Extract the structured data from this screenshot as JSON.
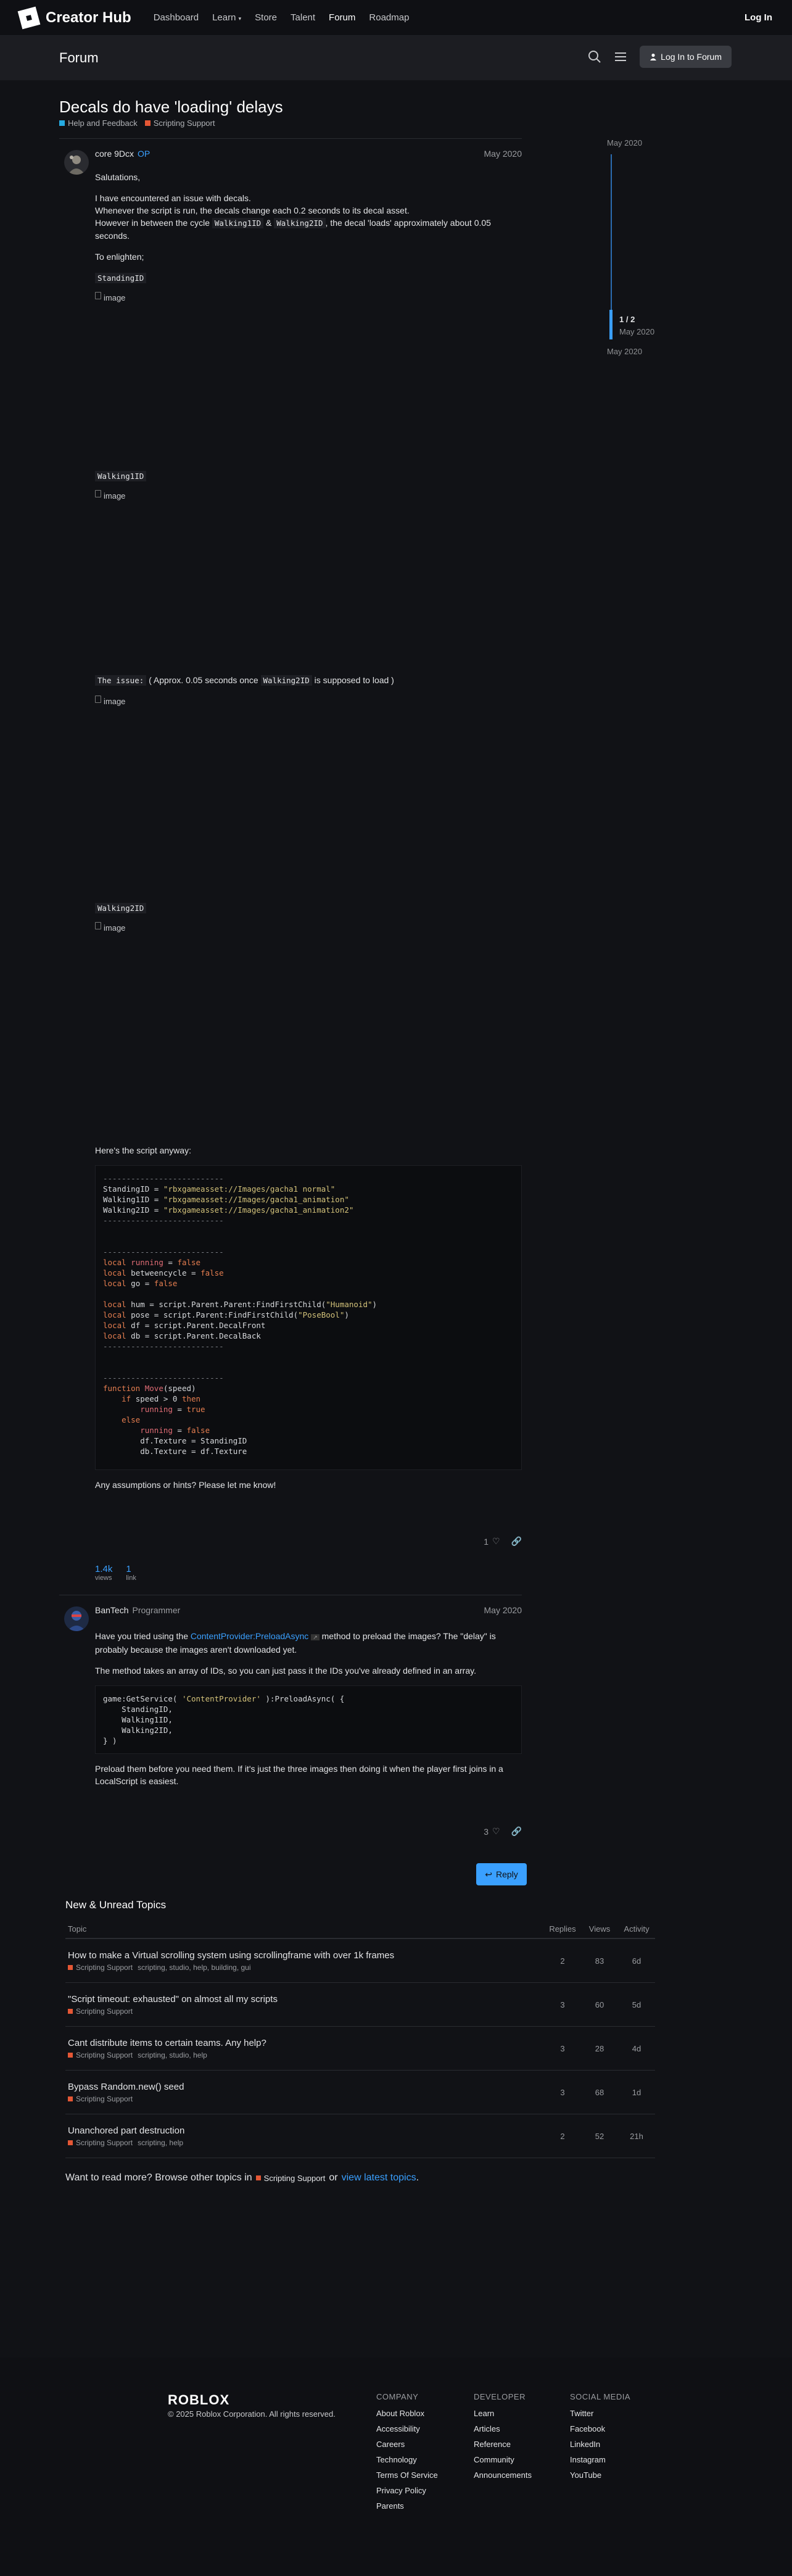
{
  "nav": {
    "brand": "Creator Hub",
    "links": [
      "Dashboard",
      "Learn",
      "Store",
      "Talent",
      "Forum",
      "Roadmap"
    ],
    "login": "Log In"
  },
  "forum_bar": {
    "title": "Forum",
    "login_button": "Log In to Forum"
  },
  "topic": {
    "title": "Decals do have 'loading' delays",
    "categories": [
      {
        "name": "Help and Feedback",
        "color": "#25aae1"
      },
      {
        "name": "Scripting Support",
        "color": "#e45735"
      }
    ]
  },
  "timeline": {
    "top_date": "May 2020",
    "position": "1 / 2",
    "position_date": "May 2020",
    "bottom_date": "May 2020"
  },
  "post1": {
    "user": "core 9Dcx",
    "badge": "OP",
    "date": "May 2020",
    "salutation": "Salutations,",
    "line1": "I have encountered an issue with decals.",
    "line2": "Whenever the script is run, the decals change each 0.2 seconds to its decal asset.",
    "line3_a": "However in between the cycle",
    "line3_code1": "Walking1ID",
    "line3_amp": "&",
    "line3_code2": "Walking2ID",
    "line3_b": ", the decal 'loads' approximately about 0.05 seconds.",
    "enlighten": "To enlighten;",
    "label_standing": "StandingID",
    "label_walking1": "Walking1ID",
    "issue_code": "The issue:",
    "issue_a": "( Approx. 0.05 seconds once",
    "issue_code2": "Walking2ID",
    "issue_b": "is supposed to load )",
    "label_walking2": "Walking2ID",
    "image_alt": "image",
    "script_intro": "Here's the script anyway:",
    "outro": "Any assumptions or hints? Please let me know!",
    "likes": "1"
  },
  "stats": {
    "views": "1.4k",
    "views_label": "views",
    "link": "1",
    "link_label": "link"
  },
  "post2": {
    "user": "BanTech",
    "role": "Programmer",
    "date": "May 2020",
    "p1_a": "Have you tried using the",
    "p1_link": "ContentProvider:PreloadAsync",
    "p1_b": "method to preload the images? The \"delay\" is probably because the images aren't downloaded yet.",
    "p2": "The method takes an array of IDs, so you can just pass it the IDs you've already defined in an array.",
    "p3": "Preload them before you need them. If it's just the three images then doing it when the player first joins in a LocalScript is easiest.",
    "likes": "3"
  },
  "reply_button": "Reply",
  "suggested": {
    "title": "New & Unread Topics",
    "headers": {
      "topic": "Topic",
      "replies": "Replies",
      "views": "Views",
      "activity": "Activity"
    },
    "rows": [
      {
        "title": "How to make a Virtual scrolling system using scrollingframe with over 1k frames",
        "category": "Scripting Support",
        "tags": "scripting, studio, help, building, gui",
        "replies": "2",
        "views": "83",
        "activity": "6d"
      },
      {
        "title": "\"Script timeout: exhausted\" on almost all my scripts",
        "category": "Scripting Support",
        "tags": "",
        "replies": "3",
        "views": "60",
        "activity": "5d"
      },
      {
        "title": "Cant distribute items to certain teams. Any help?",
        "category": "Scripting Support",
        "tags": "scripting, studio, help",
        "replies": "3",
        "views": "28",
        "activity": "4d"
      },
      {
        "title": "Bypass Random.new() seed",
        "category": "Scripting Support",
        "tags": "",
        "replies": "3",
        "views": "68",
        "activity": "1d"
      },
      {
        "title": "Unanchored part destruction",
        "category": "Scripting Support",
        "tags": "scripting, help",
        "replies": "2",
        "views": "52",
        "activity": "21h"
      }
    ],
    "more_a": "Want to read more? Browse other topics in",
    "more_cat": "Scripting Support",
    "more_or": "or",
    "more_link": "view latest topics",
    "more_end": "."
  },
  "footer": {
    "brand": "ROBLOX",
    "copyright": "© 2025 Roblox Corporation. All rights reserved.",
    "company": {
      "heading": "COMPANY",
      "items": [
        "About Roblox",
        "Accessibility",
        "Careers",
        "Technology",
        "Terms Of Service",
        "Privacy Policy",
        "Parents"
      ]
    },
    "developer": {
      "heading": "DEVELOPER",
      "items": [
        "Learn",
        "Articles",
        "Reference",
        "Community",
        "Announcements"
      ]
    },
    "social": {
      "heading": "SOCIAL MEDIA",
      "items": [
        "Twitter",
        "Facebook",
        "LinkedIn",
        "Instagram",
        "YouTube"
      ]
    }
  }
}
